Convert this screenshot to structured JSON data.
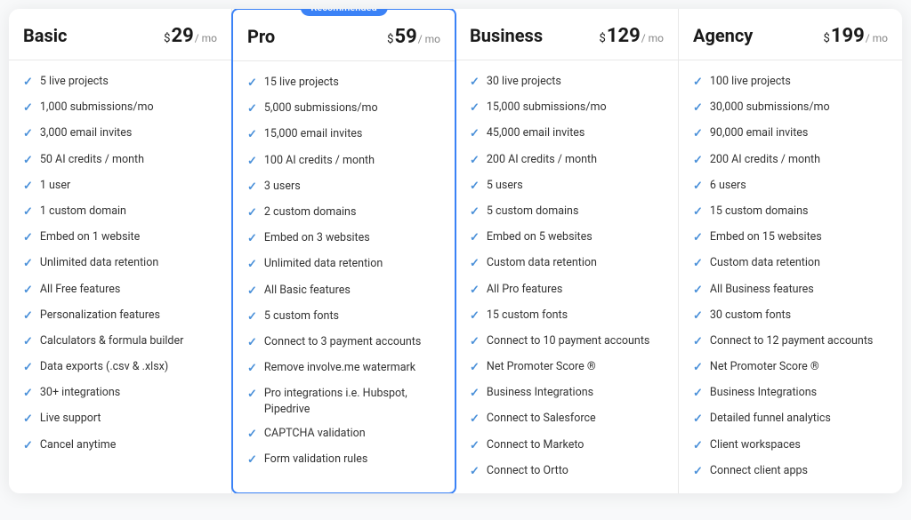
{
  "plans": [
    {
      "id": "basic",
      "name": "Basic",
      "price_symbol": "$",
      "price": "29",
      "price_mo": "/ mo",
      "recommended": false,
      "features": [
        "5 live projects",
        "1,000 submissions/mo",
        "3,000 email invites",
        "50 AI credits / month",
        "1 user",
        "1 custom domain",
        "Embed on 1 website",
        "Unlimited data retention",
        "All Free features",
        "Personalization features",
        "Calculators & formula builder",
        "Data exports (.csv & .xlsx)",
        "30+ integrations",
        "Live support",
        "Cancel anytime"
      ]
    },
    {
      "id": "pro",
      "name": "Pro",
      "price_symbol": "$",
      "price": "59",
      "price_mo": "/ mo",
      "recommended": true,
      "recommended_label": "Recommended",
      "features": [
        "15 live projects",
        "5,000 submissions/mo",
        "15,000 email invites",
        "100 AI credits / month",
        "3 users",
        "2 custom domains",
        "Embed on 3 websites",
        "Unlimited data retention",
        "All Basic features",
        "5 custom fonts",
        "Connect to 3 payment accounts",
        "Remove involve.me watermark",
        "Pro integrations i.e. Hubspot, Pipedrive",
        "CAPTCHA validation",
        "Form validation rules"
      ]
    },
    {
      "id": "business",
      "name": "Business",
      "price_symbol": "$",
      "price": "129",
      "price_mo": "/ mo",
      "recommended": false,
      "features": [
        "30 live projects",
        "15,000 submissions/mo",
        "45,000 email invites",
        "200 AI credits / month",
        "5 users",
        "5 custom domains",
        "Embed on 5 websites",
        "Custom data retention",
        "All Pro features",
        "15 custom fonts",
        "Connect to 10 payment accounts",
        "Net Promoter Score ®",
        "Business Integrations",
        "Connect to Salesforce",
        "Connect to Marketo",
        "Connect to Ortto"
      ]
    },
    {
      "id": "agency",
      "name": "Agency",
      "price_symbol": "$",
      "price": "199",
      "price_mo": "/ mo",
      "recommended": false,
      "features": [
        "100 live projects",
        "30,000 submissions/mo",
        "90,000 email invites",
        "200 AI credits / month",
        "6 users",
        "15 custom domains",
        "Embed on 15 websites",
        "Custom data retention",
        "All Business features",
        "30 custom fonts",
        "Connect to 12 payment accounts",
        "Net Promoter Score ®",
        "Business Integrations",
        "Detailed funnel analytics",
        "Client workspaces",
        "Connect client apps"
      ]
    }
  ]
}
